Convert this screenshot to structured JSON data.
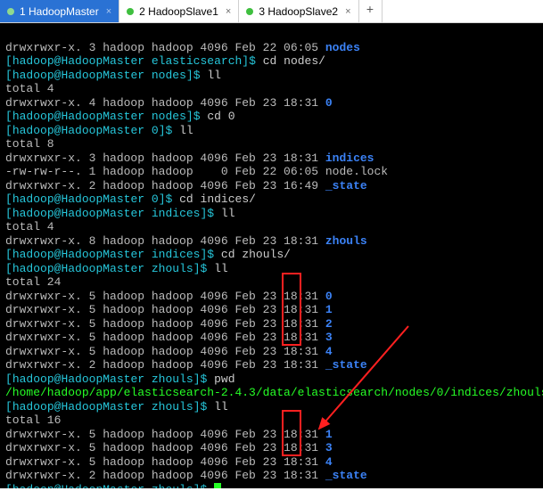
{
  "tabs": [
    {
      "label": "1 HadoopMaster",
      "active": true
    },
    {
      "label": "2 HadoopSlave1",
      "active": false
    },
    {
      "label": "3 HadoopSlave2",
      "active": false
    }
  ],
  "add_tab": "+",
  "prompt": {
    "user": "hadoop",
    "host": "HadoopMaster",
    "sigil": "$"
  },
  "lines": {
    "l0_perm": "drwxrwxr-x. 3 hadoop hadoop 4096 Feb 22 06:05 ",
    "l0_dir": "nodes",
    "l1_path": "elasticsearch",
    "l1_cmd": "cd nodes/",
    "l2_path": "nodes",
    "l2_cmd": "ll",
    "l3": "total 4",
    "l4_perm": "drwxrwxr-x. 4 hadoop hadoop 4096 Feb 23 18:31 ",
    "l4_dir": "0",
    "l5_path": "nodes",
    "l5_cmd": "cd 0",
    "l6_path": "0",
    "l6_cmd": "ll",
    "l7": "total 8",
    "l8_perm": "drwxrwxr-x. 3 hadoop hadoop 4096 Feb 23 18:31 ",
    "l8_dir": "indices",
    "l9": "-rw-rw-r--. 1 hadoop hadoop    0 Feb 22 06:05 node.lock",
    "l10_perm": "drwxrwxr-x. 2 hadoop hadoop 4096 Feb 23 16:49 ",
    "l10_dir": "_state",
    "l11_path": "0",
    "l11_cmd": "cd indices/",
    "l12_path": "indices",
    "l12_cmd": "ll",
    "l13": "total 4",
    "l14_perm": "drwxrwxr-x. 8 hadoop hadoop 4096 Feb 23 18:31 ",
    "l14_dir": "zhouls",
    "l15_path": "indices",
    "l15_cmd": "cd zhouls/",
    "l16_path": "zhouls",
    "l16_cmd": "ll",
    "l17": "total 24",
    "l18_perm": "drwxrwxr-x. 5 hadoop hadoop 4096 Feb 23 18:31 ",
    "l18_dir": "0",
    "l19_perm": "drwxrwxr-x. 5 hadoop hadoop 4096 Feb 23 18:31 ",
    "l19_dir": "1",
    "l20_perm": "drwxrwxr-x. 5 hadoop hadoop 4096 Feb 23 18:31 ",
    "l20_dir": "2",
    "l21_perm": "drwxrwxr-x. 5 hadoop hadoop 4096 Feb 23 18:31 ",
    "l21_dir": "3",
    "l22_perm": "drwxrwxr-x. 5 hadoop hadoop 4096 Feb 23 18:31 ",
    "l22_dir": "4",
    "l23_perm": "drwxrwxr-x. 2 hadoop hadoop 4096 Feb 23 18:31 ",
    "l23_dir": "_state",
    "l24_path": "zhouls",
    "l24_cmd": "pwd",
    "l25": "/home/hadoop/app/elasticsearch-2.4.3/data/elasticsearch/nodes/0/indices/zhouls",
    "l26_path": "zhouls",
    "l26_cmd": "ll",
    "l27": "total 16",
    "l28_perm": "drwxrwxr-x. 5 hadoop hadoop 4096 Feb 23 18:31 ",
    "l28_dir": "1",
    "l29_perm": "drwxrwxr-x. 5 hadoop hadoop 4096 Feb 23 18:31 ",
    "l29_dir": "3",
    "l30_perm": "drwxrwxr-x. 5 hadoop hadoop 4096 Feb 23 18:31 ",
    "l30_dir": "4",
    "l31_perm": "drwxrwxr-x. 2 hadoop hadoop 4096 Feb 23 18:31 ",
    "l31_dir": "_state",
    "l32_path": "zhouls"
  }
}
